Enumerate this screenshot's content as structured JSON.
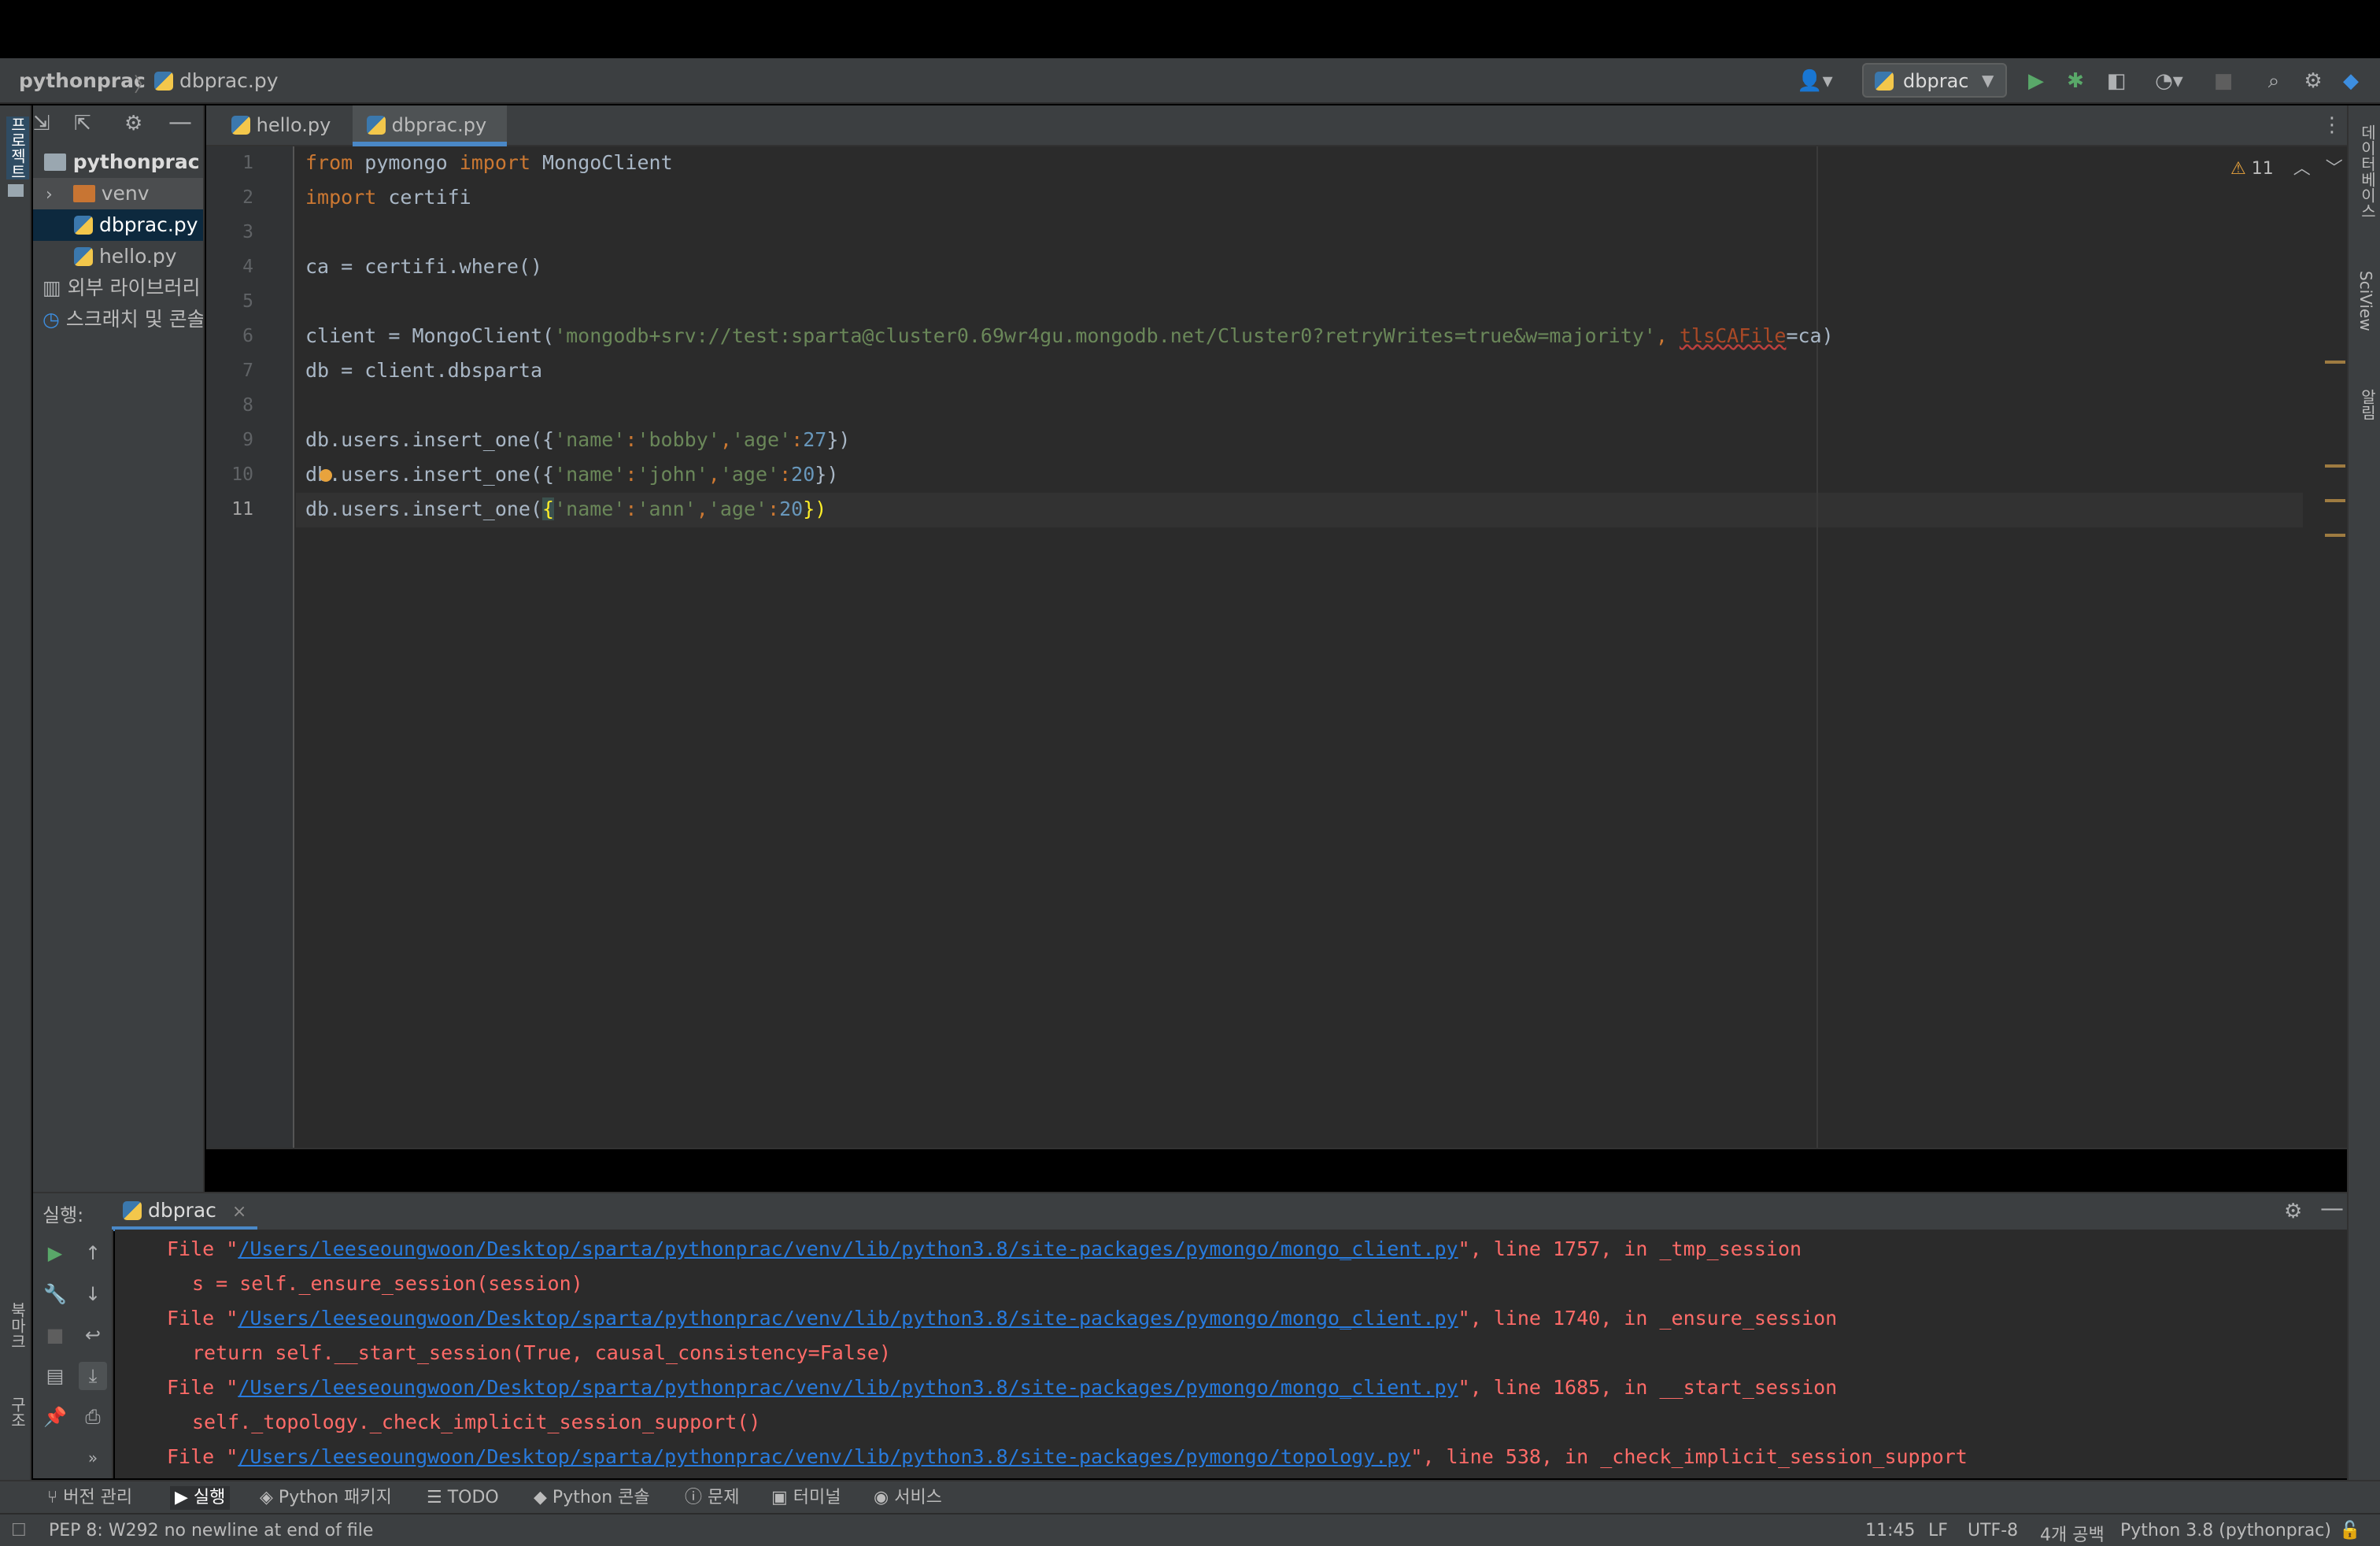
{
  "navbar": {
    "project": "pythonprac",
    "file": "dbprac.py",
    "run_config": "dbprac"
  },
  "left_strip": {
    "project_label": "프로젝트",
    "bookmarks_label": "북마크",
    "structure_label": "구조"
  },
  "right_strip": {
    "database_label": "데이터베이스",
    "sciview_label": "SciView",
    "notifications_label": "알림"
  },
  "project_tree": {
    "root": "pythonprac",
    "root_suffix": "~",
    "venv": "venv",
    "dbprac": "dbprac.py",
    "hello": "hello.py",
    "external_libs": "외부 라이브러리",
    "scratches": "스크래치 및 콘솔"
  },
  "tabs": [
    {
      "label": "hello.py",
      "close": "×"
    },
    {
      "label": "dbprac.py",
      "close": "×"
    }
  ],
  "editor": {
    "line_numbers": [
      "1",
      "2",
      "3",
      "4",
      "5",
      "6",
      "7",
      "8",
      "9",
      "10",
      "11"
    ],
    "warning_count": "11",
    "code": {
      "l1_from": "from",
      "l1_mod": " pymongo ",
      "l1_import": "import",
      "l1_name": " MongoClient",
      "l2_import": "import",
      "l2_name": " certifi",
      "l4": "ca = certifi.where()",
      "l6_pre": "client = MongoClient(",
      "l6_str": "'mongodb+srv://test:sparta@cluster0.69wr4gu.mongodb.net/Cluster0?retryWrites=true&w=majority'",
      "l6_comma": ", ",
      "l6_param": "tlsCAFile",
      "l6_post": "=ca)",
      "l7": "db = client.dbsparta",
      "l9_pre": "db.users.insert_one({",
      "l9_k1": "'name'",
      "l9_c1": ":",
      "l9_v1": "'bobby'",
      "l9_s1": ",",
      "l9_k2": "'age'",
      "l9_c2": ":",
      "l9_v2": "27",
      "l9_post": "})",
      "l10_pre": "db.users.insert_one({",
      "l10_k1": "'name'",
      "l10_c1": ":",
      "l10_v1": "'john'",
      "l10_s1": ",",
      "l10_k2": "'age'",
      "l10_c2": ":",
      "l10_v2": "20",
      "l10_post": "})",
      "l11_pre": "db.users.insert_one(",
      "l11_brace": "{",
      "l11_k1": "'name'",
      "l11_c1": ":",
      "l11_v1": "'ann'",
      "l11_s1": ",",
      "l11_k2": "'age'",
      "l11_c2": ":",
      "l11_v2": "20",
      "l11_post": "})"
    }
  },
  "run_panel": {
    "label": "실행:",
    "tab": "dbprac",
    "tab_close": "×"
  },
  "console": {
    "lines": [
      {
        "pre": "File \"",
        "link": "/Users/leeseoungwoon/Desktop/sparta/pythonprac/venv/lib/python3.8/site-packages/pymongo/mongo_client.py",
        "post": "\", line 1757, in _tmp_session"
      },
      {
        "text": "s = self._ensure_session(session)"
      },
      {
        "pre": "File \"",
        "link": "/Users/leeseoungwoon/Desktop/sparta/pythonprac/venv/lib/python3.8/site-packages/pymongo/mongo_client.py",
        "post": "\", line 1740, in _ensure_session"
      },
      {
        "text": "return self.__start_session(True, causal_consistency=False)"
      },
      {
        "pre": "File \"",
        "link": "/Users/leeseoungwoon/Desktop/sparta/pythonprac/venv/lib/python3.8/site-packages/pymongo/mongo_client.py",
        "post": "\", line 1685, in __start_session"
      },
      {
        "text": "self._topology._check_implicit_session_support()"
      },
      {
        "pre": "File \"",
        "link": "/Users/leeseoungwoon/Desktop/sparta/pythonprac/venv/lib/python3.8/site-packages/pymongo/topology.py",
        "post": "\", line 538, in _check_implicit_session_support"
      }
    ]
  },
  "tool_windows": [
    "버전 관리",
    "실행",
    "Python 패키지",
    "TODO",
    "Python 콘솔",
    "문제",
    "터미널",
    "서비스"
  ],
  "status": {
    "message": "PEP 8: W292 no newline at end of file",
    "position": "11:45",
    "line_sep": "LF",
    "encoding": "UTF-8",
    "indent": "4개 공백",
    "interpreter": "Python 3.8 (pythonprac)"
  },
  "colors": {
    "keyword": "#cc7832",
    "string": "#6a8759",
    "number": "#6897bb",
    "error": "#ff6b68",
    "link": "#287bde",
    "accent": "#4a88c7"
  }
}
